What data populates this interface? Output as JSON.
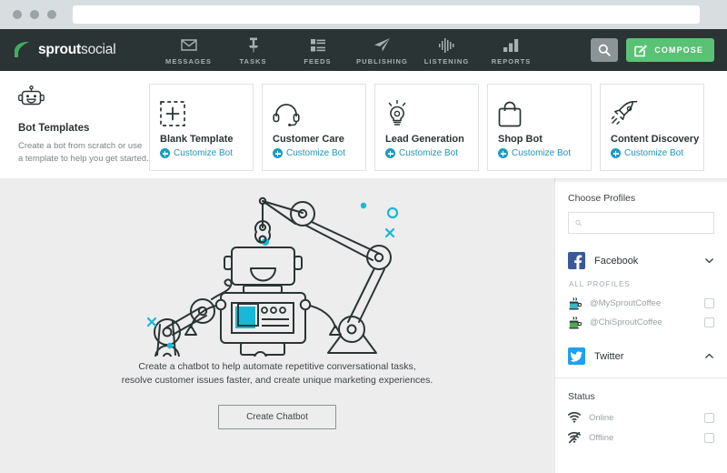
{
  "browser": {
    "url_value": "",
    "url_placeholder": ""
  },
  "nav": {
    "brand_bold": "sprout",
    "brand_light": "social",
    "items": [
      {
        "label": "MESSAGES",
        "icon": "envelope-icon"
      },
      {
        "label": "TASKS",
        "icon": "pin-icon"
      },
      {
        "label": "FEEDS",
        "icon": "feeds-icon"
      },
      {
        "label": "PUBLISHING",
        "icon": "paper-plane-icon"
      },
      {
        "label": "LISTENING",
        "icon": "waveform-icon"
      },
      {
        "label": "REPORTS",
        "icon": "bar-chart-icon"
      }
    ],
    "search_icon": "search-icon",
    "compose_label": "COMPOSE",
    "compose_icon": "compose-pencil-icon",
    "bg_color": "#2b3435",
    "accent_green": "#59c274"
  },
  "templates": {
    "robot_icon": "robot-head-icon",
    "title": "Bot Templates",
    "description": "Create a bot from scratch or use a template to help you get started.",
    "customize_label": "Customize Bot",
    "link_color": "#2196ba",
    "cards": [
      {
        "name": "Blank Template",
        "icon": "dashed-plus-icon"
      },
      {
        "name": "Customer Care",
        "icon": "headset-icon"
      },
      {
        "name": "Lead Generation",
        "icon": "lightbulb-icon"
      },
      {
        "name": "Shop Bot",
        "icon": "shopping-bag-icon"
      },
      {
        "name": "Content Discovery",
        "icon": "rocket-icon"
      }
    ]
  },
  "canvas": {
    "illustration": "robot-with-arms-illustration",
    "tagline_line1": "Create a chatbot to help automate repetitive conversational tasks,",
    "tagline_line2": "resolve customer issues faster, and create unique marketing experiences.",
    "create_button": "Create Chatbot",
    "accent_cyan": "#17b9d6",
    "bg_color": "#ededed"
  },
  "panel": {
    "heading": "Choose Profiles",
    "search_value": "",
    "search_placeholder": "",
    "search_icon": "search-icon",
    "networks": [
      {
        "name": "Facebook",
        "icon": "facebook-icon",
        "color": "#3b5998",
        "expanded": true,
        "chevron": "chevron-down-icon",
        "group_label": "ALL PROFILES",
        "profiles": [
          {
            "handle": "@MySproutCoffee",
            "avatar": "coffee-cup-blue-avatar",
            "checked": false
          },
          {
            "handle": "@ChiSproutCoffee",
            "avatar": "coffee-cup-green-avatar",
            "checked": false
          }
        ]
      },
      {
        "name": "Twitter",
        "icon": "twitter-icon",
        "color": "#1da1f2",
        "expanded": false,
        "chevron": "chevron-up-icon",
        "profiles": []
      }
    ],
    "status_heading": "Status",
    "statuses": [
      {
        "label": "Online",
        "icon": "wifi-icon",
        "checked": false
      },
      {
        "label": "Offline",
        "icon": "wifi-off-icon",
        "checked": false
      }
    ]
  }
}
